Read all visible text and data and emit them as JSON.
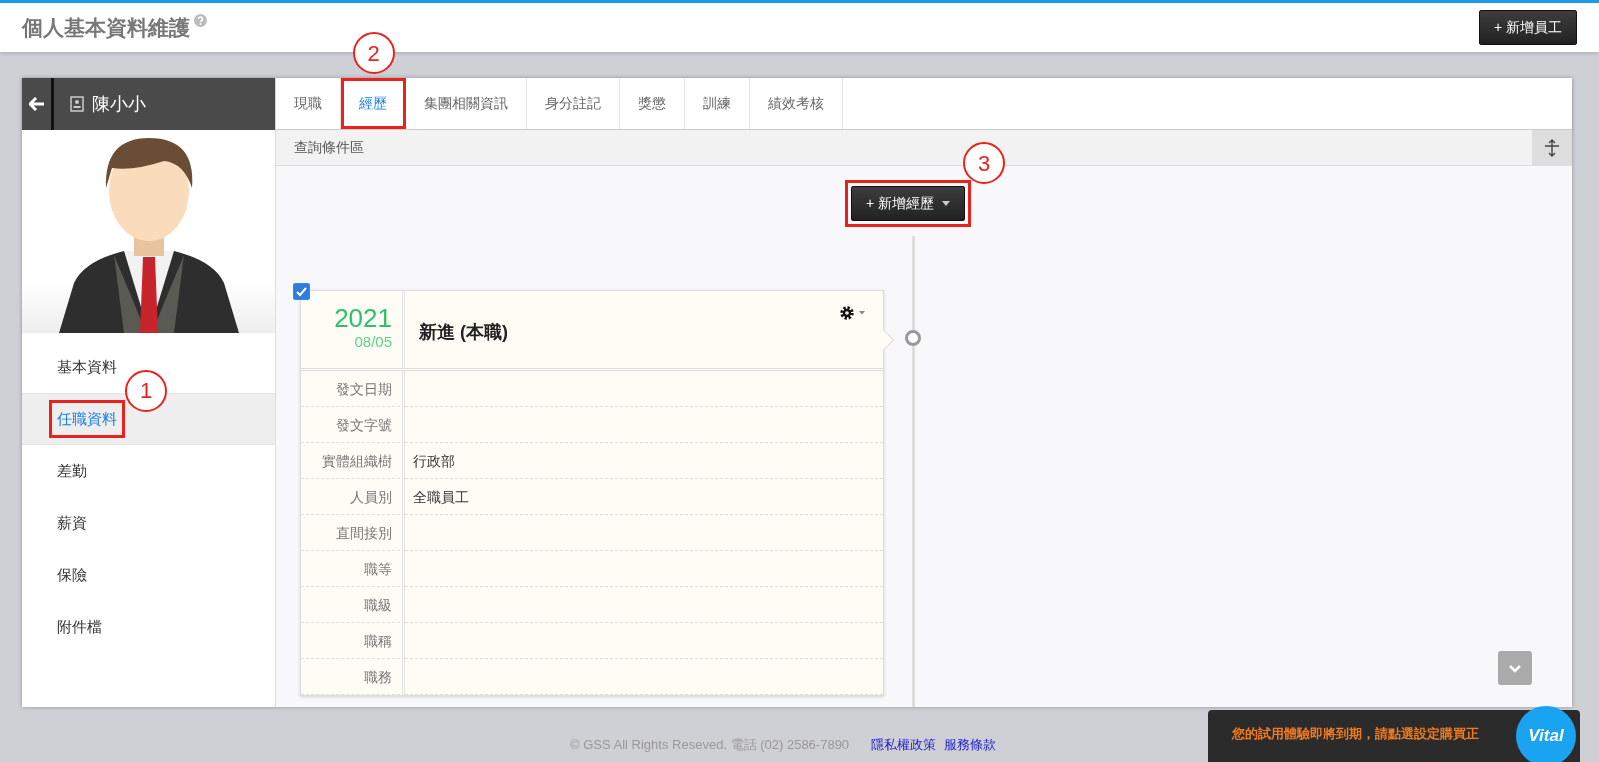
{
  "page": {
    "title": "個人基本資料維護",
    "add_button": "+ 新增員工"
  },
  "profile": {
    "name": "陳小小"
  },
  "menu": [
    {
      "label": "基本資料",
      "selected": false
    },
    {
      "label": "任職資料",
      "selected": true,
      "annotation": "1"
    },
    {
      "label": "差勤",
      "selected": false
    },
    {
      "label": "薪資",
      "selected": false
    },
    {
      "label": "保險",
      "selected": false
    },
    {
      "label": "附件檔",
      "selected": false
    }
  ],
  "tabs": [
    {
      "label": "現職",
      "selected": false
    },
    {
      "label": "經歷",
      "selected": true,
      "annotation": "2"
    },
    {
      "label": "集團相關資訊",
      "selected": false
    },
    {
      "label": "身分註記",
      "selected": false
    },
    {
      "label": "獎懲",
      "selected": false
    },
    {
      "label": "訓練",
      "selected": false
    },
    {
      "label": "績效考核",
      "selected": false
    }
  ],
  "query_bar": {
    "label": "查詢條件區"
  },
  "add_record_button": {
    "label": "+ 新增經歷",
    "annotation": "3"
  },
  "records": [
    {
      "checked": true,
      "year": "2021",
      "date": "08/05",
      "title": "新進 (本職)",
      "fields": [
        {
          "label": "發文日期"
        },
        {
          "label": "發文字號"
        },
        {
          "label": "實體組織樹",
          "value": "行政部"
        },
        {
          "label": "人員別",
          "value": "全職員工"
        },
        {
          "label": "直間接別"
        },
        {
          "label": "職等"
        },
        {
          "label": "職級"
        },
        {
          "label": "職稱"
        },
        {
          "label": "職務"
        }
      ]
    }
  ],
  "footer": {
    "copyright": "© GSS All Rights Reseved. 電話 (02) 2586-7890",
    "links": [
      "隱私權政策",
      "服務條款"
    ]
  },
  "notice": {
    "text": "您的試用體驗即將到期，請點選設定購買正",
    "logo": "Vital"
  }
}
